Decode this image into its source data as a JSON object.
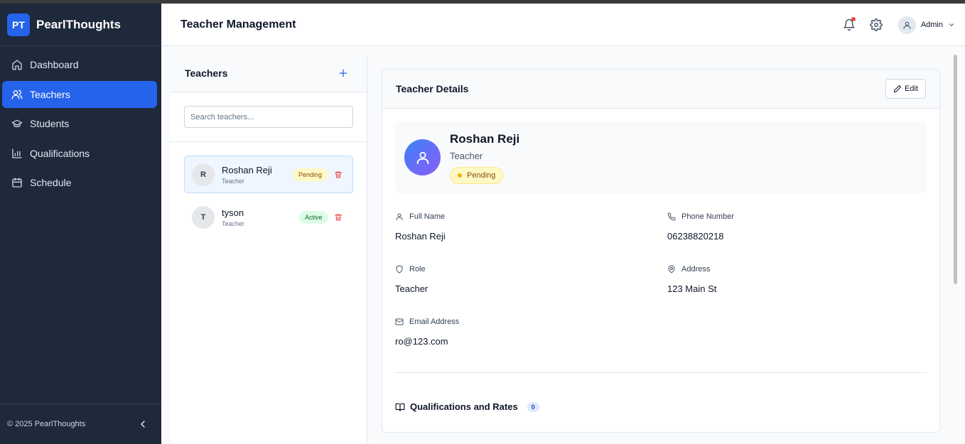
{
  "brand": {
    "logo": "PT",
    "name": "PearlThoughts"
  },
  "nav": [
    {
      "label": "Dashboard",
      "icon": "home-icon",
      "active": false
    },
    {
      "label": "Teachers",
      "icon": "users-icon",
      "active": true
    },
    {
      "label": "Students",
      "icon": "graduation-cap-icon",
      "active": false
    },
    {
      "label": "Qualifications",
      "icon": "bar-chart-icon",
      "active": false
    },
    {
      "label": "Schedule",
      "icon": "calendar-icon",
      "active": false
    }
  ],
  "footer": {
    "copyright": "© 2025 PearlThoughts"
  },
  "header": {
    "title": "Teacher Management",
    "user": "Admin",
    "has_notification": true
  },
  "teachers_panel": {
    "title": "Teachers",
    "search_placeholder": "Search teachers...",
    "items": [
      {
        "initial": "R",
        "name": "Roshan Reji",
        "role": "Teacher",
        "status": "Pending",
        "selected": true
      },
      {
        "initial": "T",
        "name": "tyson",
        "role": "Teacher",
        "status": "Active",
        "selected": false
      }
    ]
  },
  "details": {
    "title": "Teacher Details",
    "edit_label": "Edit",
    "name": "Roshan Reji",
    "role": "Teacher",
    "status": "Pending",
    "fields": {
      "full_name": {
        "label": "Full Name",
        "value": "Roshan Reji"
      },
      "phone": {
        "label": "Phone Number",
        "value": "06238820218"
      },
      "role": {
        "label": "Role",
        "value": "Teacher"
      },
      "address": {
        "label": "Address",
        "value": "123 Main St"
      },
      "email": {
        "label": "Email Address",
        "value": "ro@123.com"
      }
    },
    "qualifications": {
      "title": "Qualifications and Rates",
      "count": "0"
    }
  },
  "colors": {
    "sidebar": "#1e293b",
    "accent": "#2563eb",
    "pending": "#fef9c3",
    "active": "#dcfce7"
  }
}
